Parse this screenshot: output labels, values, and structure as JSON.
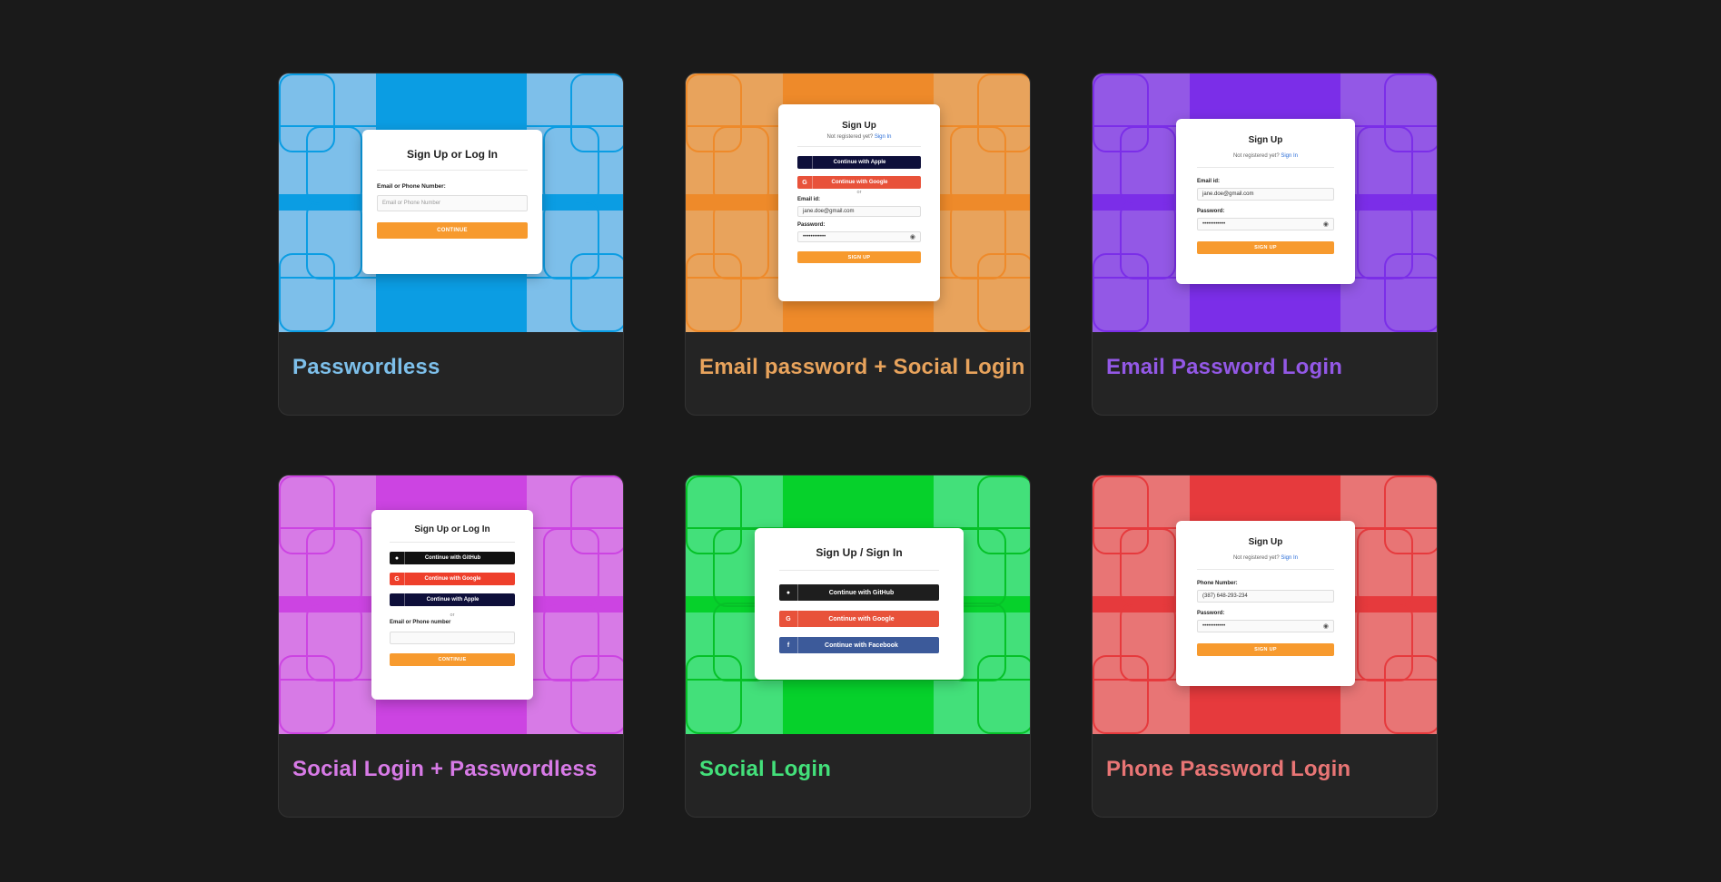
{
  "cards": [
    {
      "title": "Passwordless",
      "colors": {
        "bg": "#7dbfea",
        "stripe": "#0b9de3",
        "line": "#0b9de3",
        "title": "#7dbfea"
      },
      "modal": {
        "title": "Sign Up or Log In",
        "email_label": "Email or Phone Number:",
        "email_placeholder": "Email or Phone Number",
        "button": "CONTINUE"
      }
    },
    {
      "title": "Email password + Social Login",
      "colors": {
        "bg": "#e8a35c",
        "stripe": "#ee8a2a",
        "line": "#ee8a2a",
        "title": "#e8a35c"
      },
      "modal": {
        "title": "Sign Up",
        "subtitle": "Not registered yet?",
        "subtitle_link": "Sign In",
        "apple": "Continue with Apple",
        "google": "Continue with Google",
        "or": "or",
        "email_label": "Email id:",
        "email_value": "jane.doe@gmail.com",
        "password_label": "Password:",
        "password_value": "••••••••••••",
        "button": "SIGN UP"
      }
    },
    {
      "title": "Email Password Login",
      "colors": {
        "bg": "#9358e6",
        "stripe": "#7b2ee8",
        "line": "#7b2ee8",
        "title": "#9358e6"
      },
      "modal": {
        "title": "Sign Up",
        "subtitle": "Not registered yet?",
        "subtitle_link": "Sign In",
        "email_label": "Email id:",
        "email_value": "jane.doe@gmail.com",
        "password_label": "Password:",
        "password_value": "••••••••••••",
        "button": "SIGN UP"
      }
    },
    {
      "title": "Social Login + Passwordless",
      "colors": {
        "bg": "#d77ae6",
        "stripe": "#cc44e2",
        "line": "#cc44e2",
        "title": "#d77ae6"
      },
      "modal": {
        "title": "Sign Up or Log In",
        "github": "Continue with GitHub",
        "google": "Continue with Google",
        "apple": "Continue with Apple",
        "or": "or",
        "email_label": "Email or Phone number",
        "email_value": "",
        "button": "CONTINUE"
      }
    },
    {
      "title": "Social Login",
      "colors": {
        "bg": "#43e07a",
        "stripe": "#06d12b",
        "line": "#06c128",
        "title": "#43e07a"
      },
      "modal": {
        "title": "Sign Up / Sign In",
        "github": "Continue with GitHub",
        "google": "Continue with Google",
        "facebook": "Continue with Facebook"
      }
    },
    {
      "title": "Phone Password Login",
      "colors": {
        "bg": "#e87575",
        "stripe": "#e63a3d",
        "line": "#e63a3d",
        "title": "#e87575"
      },
      "modal": {
        "title": "Sign Up",
        "subtitle": "Not registered yet?",
        "subtitle_link": "Sign In",
        "phone_label": "Phone Number:",
        "phone_value": "(387) 648-293-234",
        "password_label": "Password:",
        "password_value": "••••••••••••",
        "button": "SIGN UP"
      }
    }
  ],
  "brand": {
    "apple": "#0e0f3a",
    "google": "#e8523a",
    "github": "#1e1e1e",
    "facebook": "#3c5a9a",
    "button": "#f79a2e"
  }
}
